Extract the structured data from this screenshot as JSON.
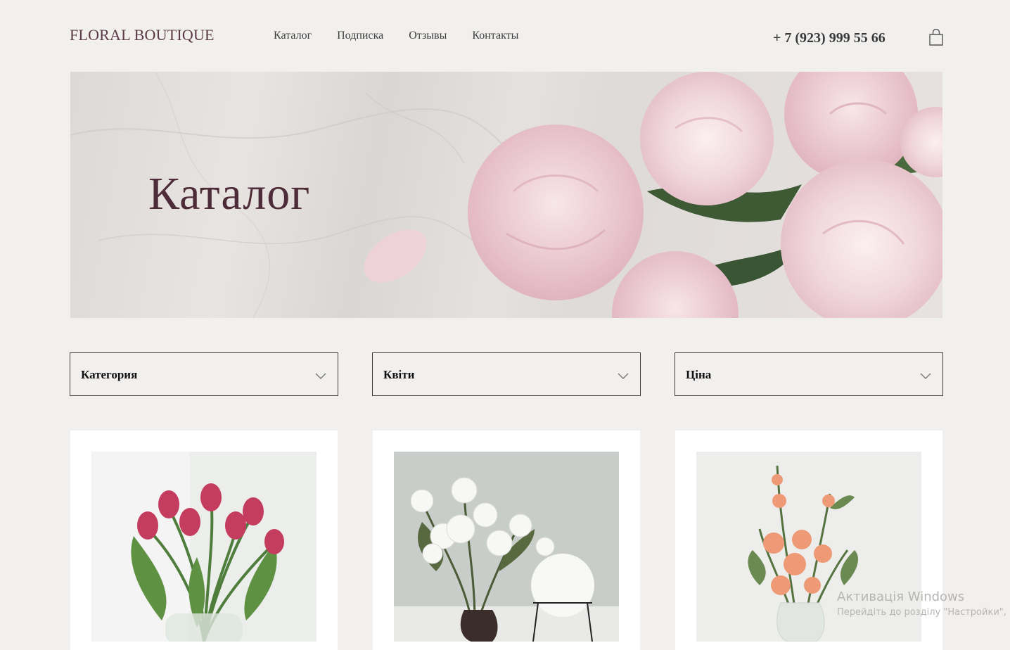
{
  "header": {
    "logo": "FLORAL BOUTIQUE",
    "nav": [
      "Каталог",
      "Подписка",
      "Отзывы",
      "Контакты"
    ],
    "phone": "+ 7 (923) 999 55 66",
    "cart_icon": "shopping-bag-icon"
  },
  "hero": {
    "title": "Каталог"
  },
  "filters": [
    {
      "label": "Категория",
      "icon": "chevron-down-icon"
    },
    {
      "label": "Квіти",
      "icon": "chevron-down-icon"
    },
    {
      "label": "Ціна",
      "icon": "chevron-down-icon"
    }
  ],
  "products": [
    {
      "image": "pink tulips in glass vase"
    },
    {
      "image": "white peonies in dark vase with white sphere"
    },
    {
      "image": "orange roses and gladiolus bouquet in glass vase"
    }
  ],
  "watermark": {
    "line1": "Активація Windows",
    "line2": "Перейдіть до розділу \"Настройки\","
  },
  "colors": {
    "background": "#f1f0ee",
    "brand": "#5a3a44",
    "hero_title": "#4e2b38",
    "card": "#ffffff"
  }
}
